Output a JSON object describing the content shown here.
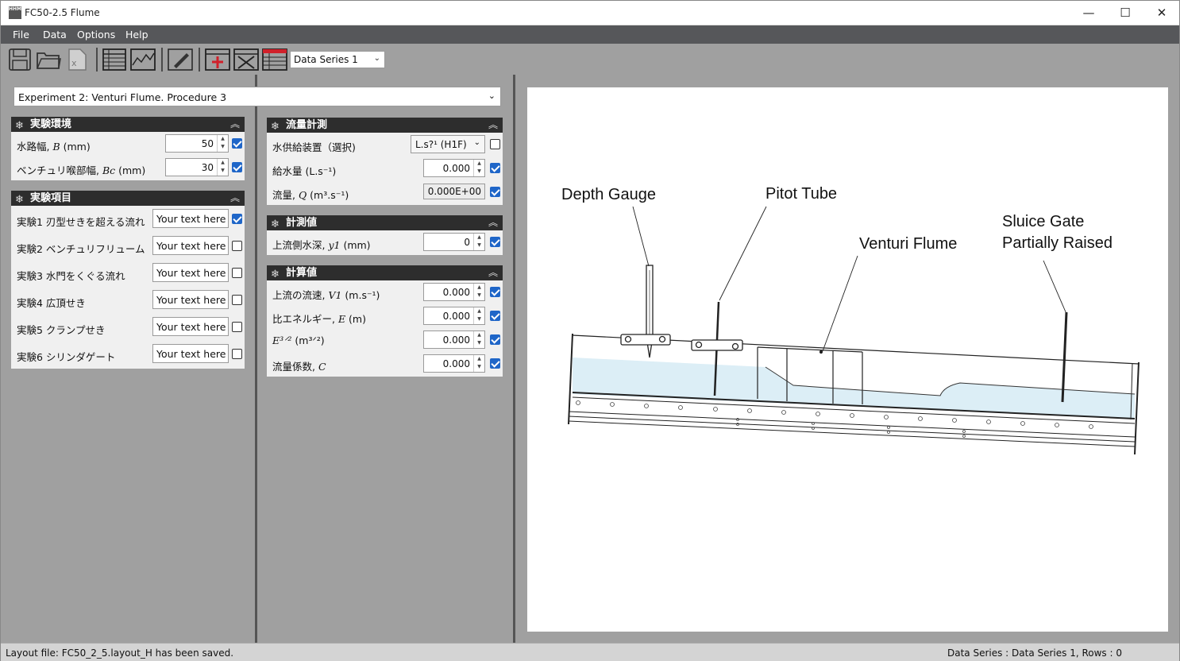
{
  "window": {
    "title": "FC50-2.5 Flume",
    "app_icon_text": "HHM",
    "minimize": "—",
    "maximize": "☐",
    "close": "✕"
  },
  "menu": {
    "file": "File",
    "data": "Data",
    "options": "Options",
    "help": "Help"
  },
  "toolbar": {
    "icons": [
      "save-icon",
      "open-folder-icon",
      "excel-export-icon",
      "table-view-icon",
      "chart-view-icon",
      "edit-pencil-icon",
      "add-row-icon",
      "delete-row-icon",
      "table-settings-icon"
    ],
    "series_selected": "Data Series 1"
  },
  "experiment_select": "Experiment 2: Venturi Flume. Procedure 3",
  "env_panel": {
    "title": "実験環境",
    "rows": [
      {
        "label": "水路幅, ",
        "sym": "B",
        "unit": " (mm)",
        "value": "50",
        "checked": true
      },
      {
        "label": "ベンチュリ喉部幅, ",
        "sym": "Bc",
        "unit": " (mm)",
        "value": "30",
        "checked": true
      }
    ]
  },
  "exp_panel": {
    "title": "実験項目",
    "rows": [
      {
        "label": "実験1   刃型せきを超える流れ",
        "value": "Your text here",
        "checked": true
      },
      {
        "label": "実験2   ベンチュリフリューム",
        "value": "Your text here",
        "checked": false
      },
      {
        "label": "実験3   水門をくぐる流れ",
        "value": "Your text here",
        "checked": false
      },
      {
        "label": "実験4   広頂せき",
        "value": "Your text here",
        "checked": false
      },
      {
        "label": "実験5   クランプせき",
        "value": "Your text here",
        "checked": false
      },
      {
        "label": "実験6   シリンダゲート",
        "value": "Your text here",
        "checked": false
      }
    ]
  },
  "flow_panel": {
    "title": "流量計測",
    "supply_label": "水供給装置（選択)",
    "supply_value": "L.s?¹ (H1F)",
    "supply_checked": false,
    "feed_label": "給水量 (L.s⁻¹)",
    "feed_value": "0.000",
    "feed_checked": true,
    "q_label": "流量, ",
    "q_sym": "Q",
    "q_unit": " (m³.s⁻¹)",
    "q_value": "0.000E+00",
    "q_checked": true
  },
  "meas_panel": {
    "title": "計測値",
    "label": "上流側水深, ",
    "sym": "y1",
    "unit": " (mm)",
    "value": "0",
    "checked": true
  },
  "calc_panel": {
    "title": "計算値",
    "rows": [
      {
        "label": "上流の流速, ",
        "sym": "V1",
        "unit": " (m.s⁻¹)",
        "value": "0.000",
        "checked": true
      },
      {
        "label": "比エネルギー, ",
        "sym": "E",
        "unit": " (m)",
        "value": "0.000",
        "checked": true
      },
      {
        "label": "",
        "sym": "E³ᐟ²",
        "unit": " (m³ᐟ²)",
        "value": "0.000",
        "checked": true
      },
      {
        "label": "流量係数, ",
        "sym": "C",
        "unit": "",
        "value": "0.000",
        "checked": true
      }
    ]
  },
  "diagram": {
    "labels": {
      "depth_gauge": "Depth Gauge",
      "pitot_tube": "Pitot Tube",
      "venturi_flume": "Venturi Flume",
      "sluice_gate_1": "Sluice Gate",
      "sluice_gate_2": "Partially Raised"
    },
    "colors": {
      "water": "#dceef6",
      "line": "#222222"
    }
  },
  "status": {
    "left": "Layout file: FC50_2_5.layout_H has been saved.",
    "right": "Data Series : Data Series 1,  Rows : 0"
  }
}
